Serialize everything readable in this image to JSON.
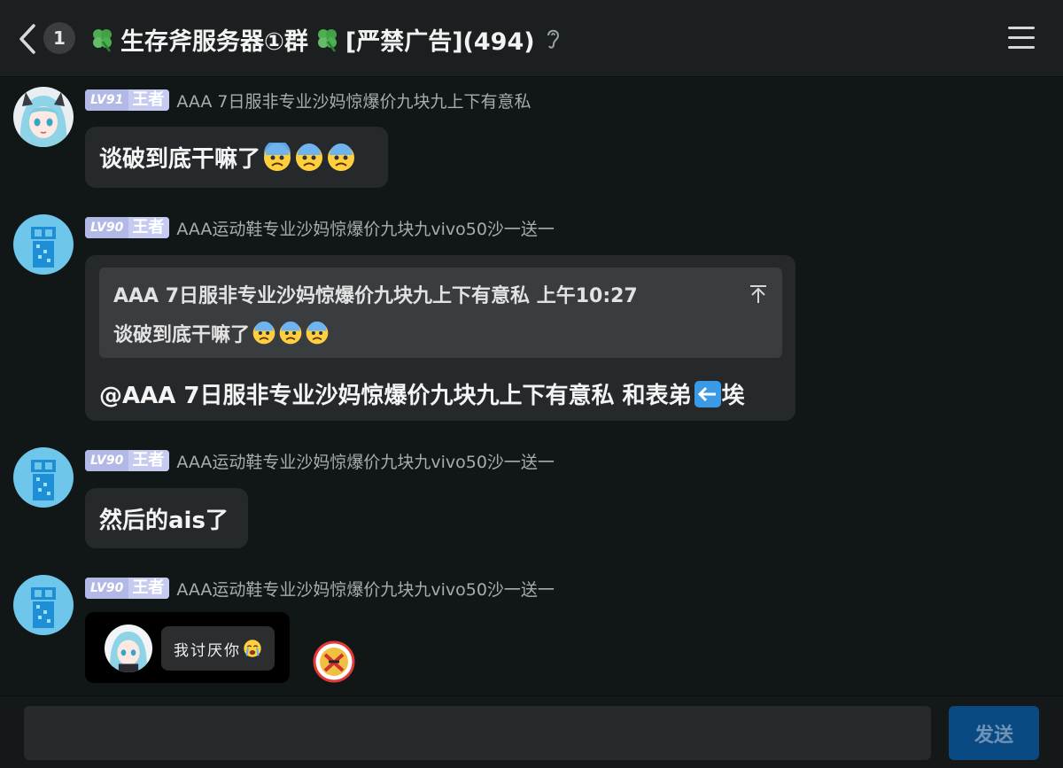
{
  "header": {
    "unread_count": "1",
    "title": "生存斧服务器①群",
    "title_suffix": "[严禁广告](494)"
  },
  "messages": [
    {
      "level": "LV91",
      "rank": "王者",
      "nickname": "AAA 7日服非专业沙妈惊爆价九块九上下有意私",
      "text": "谈破到底干嘛了"
    },
    {
      "level": "LV90",
      "rank": "王者",
      "nickname": "AAA运动鞋专业沙妈惊爆价九块九vivo50沙一送一",
      "quote_header": "AAA 7日服非专业沙妈惊爆价九块九上下有意私  上午10:27",
      "quote_text": "谈破到底干嘛了",
      "text": "@AAA 7日服非专业沙妈惊爆价九块九上下有意私  和表弟",
      "text_tail": "埃"
    },
    {
      "level": "LV90",
      "rank": "王者",
      "nickname": "AAA运动鞋专业沙妈惊爆价九块九vivo50沙一送一",
      "text": "然后的ais了"
    },
    {
      "level": "LV90",
      "rank": "王者",
      "nickname": "AAA运动鞋专业沙妈惊爆价九块九vivo50沙一送一",
      "sticker_text": "我讨厌你"
    }
  ],
  "input": {
    "value": "",
    "placeholder": "",
    "send_label": "发送"
  },
  "colors": {
    "background": "#111617",
    "bubble": "#25292b",
    "send_button": "#0a4a82",
    "level_badge": "#c6cbef"
  },
  "icons": [
    "back-arrow-icon",
    "clover-icon",
    "ear-icon",
    "menu-icon",
    "anxious-face-emoji",
    "left-arrow-emoji",
    "crying-face-emoji",
    "dui-reaction-icon"
  ]
}
